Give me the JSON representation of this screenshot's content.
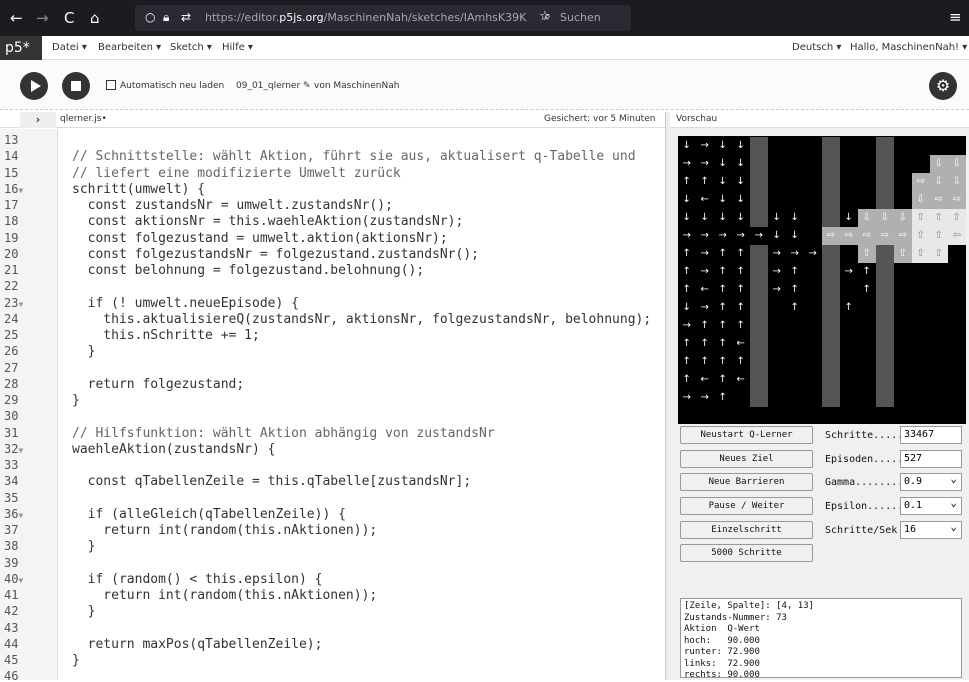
{
  "browser": {
    "back": "←",
    "forward": "→",
    "reload": "C",
    "home": "⌂",
    "url_prefix": "https://editor.",
    "url_domain": "p5js.org",
    "url_path": "/MaschinenNah/sketches/IAmhsK39K",
    "search": "Suchen",
    "menu": "≡"
  },
  "p5menu": {
    "logo": "p5*",
    "items": [
      "Datei ▾",
      "Bearbeiten ▾",
      "Sketch ▾",
      "Hilfe ▾"
    ],
    "language": "Deutsch ▾",
    "user": "Hallo, MaschinenNah! ▾"
  },
  "toolbar": {
    "autoreload_label": "Automatisch neu laden",
    "sketch_name": "09_01_qlerner ✎",
    "author": "von MaschinenNah",
    "settings": "⚙"
  },
  "tab": {
    "collapse": "›",
    "filename": "qlerner.js•",
    "saved": "Gesichert: vor 5 Minuten",
    "preview": "Vorschau"
  },
  "code_lines": [
    {
      "n": "13",
      "t": ""
    },
    {
      "n": "14",
      "t": "// Schnittstelle: wählt Aktion, führt sie aus, aktualisert q-Tabelle und",
      "cls": "c-com"
    },
    {
      "n": "15",
      "t": "// liefert eine modifizierte Umwelt zurück",
      "cls": "c-com"
    },
    {
      "n": "16",
      "t": "schritt(umwelt) {",
      "fold": true
    },
    {
      "n": "17",
      "t": "  const zustandsNr = umwelt.zustandsNr();"
    },
    {
      "n": "18",
      "t": "  const aktionsNr = this.waehleAktion(zustandsNr);"
    },
    {
      "n": "19",
      "t": "  const folgezustand = umwelt.aktion(aktionsNr);"
    },
    {
      "n": "20",
      "t": "  const folgezustandsNr = folgezustand.zustandsNr();"
    },
    {
      "n": "21",
      "t": "  const belohnung = folgezustand.belohnung();"
    },
    {
      "n": "22",
      "t": ""
    },
    {
      "n": "23",
      "t": "  if (! umwelt.neueEpisode) {",
      "fold": true
    },
    {
      "n": "24",
      "t": "    this.aktualisiereQ(zustandsNr, aktionsNr, folgezustandsNr, belohnung);"
    },
    {
      "n": "25",
      "t": "    this.nSchritte += 1;"
    },
    {
      "n": "26",
      "t": "  }"
    },
    {
      "n": "27",
      "t": ""
    },
    {
      "n": "28",
      "t": "  return folgezustand;"
    },
    {
      "n": "29",
      "t": "}"
    },
    {
      "n": "30",
      "t": ""
    },
    {
      "n": "31",
      "t": "// Hilfsfunktion: wählt Aktion abhängig von zustandsNr",
      "cls": "c-com"
    },
    {
      "n": "32",
      "t": "waehleAktion(zustandsNr) {",
      "fold": true
    },
    {
      "n": "33",
      "t": ""
    },
    {
      "n": "34",
      "t": "  const qTabellenZeile = this.qTabelle[zustandsNr];"
    },
    {
      "n": "35",
      "t": ""
    },
    {
      "n": "36",
      "t": "  if (alleGleich(qTabellenZeile)) {",
      "fold": true
    },
    {
      "n": "37",
      "t": "    return int(random(this.nAktionen));"
    },
    {
      "n": "38",
      "t": "  }"
    },
    {
      "n": "39",
      "t": ""
    },
    {
      "n": "40",
      "t": "  if (random() < this.epsilon) {",
      "fold": true
    },
    {
      "n": "41",
      "t": "    return int(random(this.nAktionen));"
    },
    {
      "n": "42",
      "t": "  }"
    },
    {
      "n": "43",
      "t": ""
    },
    {
      "n": "44",
      "t": "  return maxPos(qTabellenZeile);"
    },
    {
      "n": "45",
      "t": "}"
    },
    {
      "n": "46",
      "t": ""
    }
  ],
  "controls": {
    "buttons": [
      "Neustart Q-Lerner",
      "Neues Ziel",
      "Neue Barrieren",
      "Pause / Weiter",
      "Einzelschritt",
      "5000 Schritte"
    ],
    "labels": [
      "Schritte.....",
      "Episoden.....",
      "Gamma........",
      "Epsilon......",
      "Schritte/Sek"
    ],
    "schritte": "33467",
    "episoden": "527",
    "gamma": "0.9",
    "epsilon": "0.1",
    "speed": "16"
  },
  "info": {
    "text": "[Zeile, Spalte]: [4, 13]\nZustands-Nummer: 73\nAktion  Q-Wert\nhoch:   90.000\nrunter: 72.900\nlinks:  72.900\nrechts: 90.000"
  },
  "grid_rows": [
    "↓→↓↓G...G..G....",
    "→→↓↓G...G..G..⇩⇩",
    "↑↑↓↓G...G..G.⇨⇩⇩",
    "↓←↓↓G...G..G.⇩⇨⇨",
    "↓↓↓↓G↓↓.G↓⇩⇩⇩⇧⇧⇧",
    "→→→→→↓↓.⇨⇨⇨⇨⇨⇧⇧⇦",
    "↑→↑↑G→→→G.⇧G⇧⇧⇧.",
    "↑→↑↑G→↑.G→↑G....",
    "↑←↑↑G→↑.G.↑G....",
    "↓→↑↑G.↑.G↑.G....",
    "→↑↑↑G...G..G....",
    "↑↑↑←G...G..G....",
    "↑↑↑↑G...G..G....",
    "↑←↑←G...G..G....",
    "→→↑.G...G..G...."
  ]
}
